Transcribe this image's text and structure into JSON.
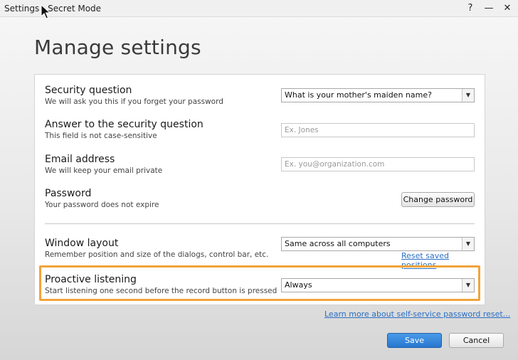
{
  "window": {
    "title": "Settings - Secret Mode",
    "help": "?",
    "minimize": "—",
    "close": "✕"
  },
  "page_title": "Manage settings",
  "settings": {
    "security_question": {
      "title": "Security question",
      "description": "We will ask you this if you forget your password",
      "value": "What is your mother's maiden name?"
    },
    "answer": {
      "title": "Answer to the security question",
      "description": "This field is not case-sensitive",
      "placeholder": "Ex. Jones"
    },
    "email": {
      "title": "Email address",
      "description": "We will keep your email private",
      "placeholder": "Ex. you@organization.com"
    },
    "password": {
      "title": "Password",
      "description": "Your password does not expire",
      "button": "Change password"
    },
    "window_layout": {
      "title": "Window layout",
      "description": "Remember position and size of the dialogs, control bar, etc.",
      "value": "Same across all computers",
      "link": "Reset saved positions"
    },
    "proactive_listening": {
      "title": "Proactive listening",
      "description": "Start listening one second before the record button is pressed",
      "value": "Always"
    }
  },
  "learn_more_link": "Learn more about self-service password reset...",
  "footer": {
    "save": "Save",
    "cancel": "Cancel"
  },
  "colors": {
    "accent": "#2877cf",
    "highlight": "#f0a43a",
    "link": "#2a6fc4"
  },
  "icons": {
    "dropdown": "chevron-down-icon",
    "cursor": "mouse-pointer-icon"
  }
}
